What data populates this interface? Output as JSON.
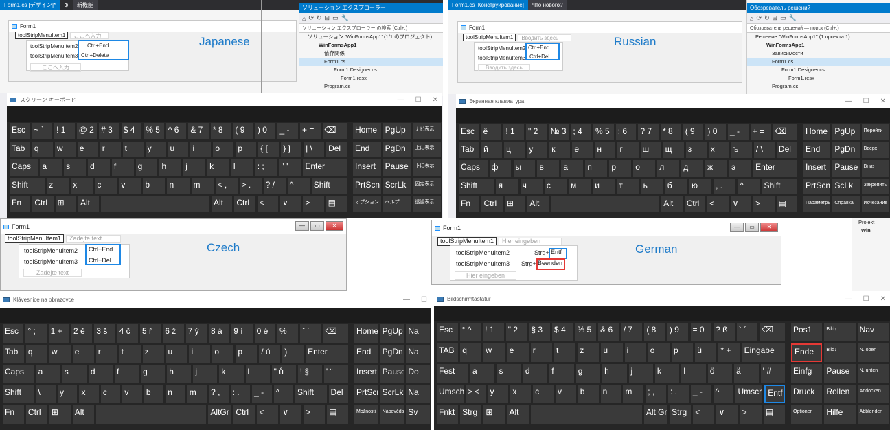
{
  "quadrants": {
    "japanese": {
      "label": "Japanese",
      "tabs": [
        "Form1.cs [デザイン]*",
        "⊕",
        "新機能"
      ],
      "form_title": "Form1",
      "menu_top": "toolStripMenuItem1",
      "menu_typehere": "ここへ入力",
      "items": [
        {
          "name": "toolStripMenuItem2",
          "shortcut": "Ctrl+End"
        },
        {
          "name": "toolStripMenuItem3",
          "shortcut": "Ctrl+Delete"
        }
      ],
      "item_typehere": "ここへ入力",
      "solution": {
        "title": "ソリューション エクスプローラー",
        "search": "ソリューション エクスプローラー の検索 (Ctrl+;)",
        "tree": [
          "ソリューション 'WinFormsApp1' (1/1 のプロジェクト)",
          "WinFormsApp1",
          "依存関係",
          "Form1.cs",
          "Form1.Designer.cs",
          "Form1.resx",
          "Program.cs"
        ]
      },
      "osk_title": "スクリーン キーボード",
      "osk_nav": [
        [
          "Home",
          "PgUp",
          "ナビ表示"
        ],
        [
          "End",
          "PgDn",
          "上に表示"
        ],
        [
          "Insert",
          "Pause",
          "下に表示"
        ],
        [
          "PrtScn",
          "ScrLk",
          "固定表示"
        ],
        [
          "オプション",
          "ヘルプ",
          "透過表示"
        ]
      ],
      "osk_rows": [
        [
          "Esc",
          "~ `",
          "! 1",
          "@ 2",
          "# 3",
          "$ 4",
          "% 5",
          "^ 6",
          "& 7",
          "* 8",
          "( 9",
          ") 0",
          "_ -",
          "+ =",
          "⌫"
        ],
        [
          "Tab",
          "q",
          "w",
          "e",
          "r",
          "t",
          "y",
          "u",
          "i",
          "o",
          "p",
          "{ [",
          "} ]",
          "| \\",
          "Del"
        ],
        [
          "Caps",
          "a",
          "s",
          "d",
          "f",
          "g",
          "h",
          "j",
          "k",
          "l",
          ": ;",
          "\" '",
          "Enter"
        ],
        [
          "Shift",
          "z",
          "x",
          "c",
          "v",
          "b",
          "n",
          "m",
          "< ,",
          "> .",
          "? /",
          "^",
          "Shift"
        ],
        [
          "Fn",
          "Ctrl",
          "⊞",
          "Alt",
          "",
          "Alt",
          "Ctrl",
          "<",
          "∨",
          ">",
          "▤"
        ]
      ]
    },
    "russian": {
      "label": "Russian",
      "tabs": [
        "Form1.cs [Конструирование]",
        "Что нового?"
      ],
      "form_title": "Form1",
      "menu_top": "toolStripMenuItem1",
      "menu_typehere": "Вводить здесь",
      "items": [
        {
          "name": "toolStripMenuItem2",
          "shortcut": "Ctrl+End"
        },
        {
          "name": "toolStripMenuItem3",
          "shortcut": "Ctrl+Del"
        }
      ],
      "item_typehere": "Вводить здесь",
      "solution": {
        "title": "Обозреватель решений",
        "search": "Обозреватель решений — поиск (Ctrl+;)",
        "tree": [
          "Решение \"WinFormsApp1\" (1 проекта 1)",
          "WinFormsApp1",
          "Зависимости",
          "Form1.cs",
          "Form1.Designer.cs",
          "Form1.resx",
          "Program.cs"
        ]
      },
      "osk_title": "Экранная клавиатура",
      "osk_nav": [
        [
          "Home",
          "PgUp",
          "Перейти"
        ],
        [
          "End",
          "PgDn",
          "Вверх"
        ],
        [
          "Insert",
          "Pause",
          "Вниз"
        ],
        [
          "PrtScn",
          "ScLk",
          "Закрепить"
        ],
        [
          "Параметры",
          "Справка",
          "Исчезание"
        ]
      ],
      "osk_rows": [
        [
          "Esc",
          "ё",
          "! 1",
          "\" 2",
          "№ 3",
          "; 4",
          "% 5",
          ": 6",
          "? 7",
          "* 8",
          "( 9",
          ") 0",
          "_ -",
          "+ =",
          "⌫"
        ],
        [
          "Tab",
          "й",
          "ц",
          "у",
          "к",
          "е",
          "н",
          "г",
          "ш",
          "щ",
          "з",
          "х",
          "ъ",
          "/ \\",
          "Del"
        ],
        [
          "Caps",
          "ф",
          "ы",
          "в",
          "а",
          "п",
          "р",
          "о",
          "л",
          "д",
          "ж",
          "э",
          "Enter"
        ],
        [
          "Shift",
          "я",
          "ч",
          "с",
          "м",
          "и",
          "т",
          "ь",
          "б",
          "ю",
          ", .",
          "^",
          "Shift"
        ],
        [
          "Fn",
          "Ctrl",
          "⊞",
          "Alt",
          "",
          "Alt",
          "Ctrl",
          "<",
          "∨",
          ">",
          "▤"
        ]
      ]
    },
    "czech": {
      "label": "Czech",
      "form_title": "Form1",
      "menu_top": "toolStripMenuItem1",
      "menu_typehere": "Zadejte text",
      "items": [
        {
          "name": "toolStripMenuItem2",
          "shortcut": "Ctrl+End"
        },
        {
          "name": "toolStripMenuItem3",
          "shortcut": "Ctrl+Del"
        }
      ],
      "item_typehere": "Zadejte text",
      "osk_title": "Klávesnice na obrazovce",
      "osk_nav": [
        [
          "Home",
          "PgUp",
          "Na"
        ],
        [
          "End",
          "PgDn",
          "Na"
        ],
        [
          "Insert",
          "Pause",
          "Do"
        ],
        [
          "PrtScn",
          "ScrLk",
          "Na"
        ],
        [
          "Možnosti",
          "Nápověda",
          "Sv"
        ]
      ],
      "osk_rows": [
        [
          "Esc",
          "° ;",
          "1 +",
          "2 ě",
          "3 š",
          "4 č",
          "5 ř",
          "6 ž",
          "7 ý",
          "8 á",
          "9 í",
          "0 é",
          "% =",
          "ˇ ´",
          "⌫"
        ],
        [
          "Tab",
          "q",
          "w",
          "e",
          "r",
          "t",
          "z",
          "u",
          "i",
          "o",
          "p",
          "/ ú",
          ")",
          "Enter"
        ],
        [
          "Caps",
          "a",
          "s",
          "d",
          "f",
          "g",
          "h",
          "j",
          "k",
          "l",
          "\" ů",
          "! §",
          "' ¨"
        ],
        [
          "Shift",
          "\\",
          "y",
          "x",
          "c",
          "v",
          "b",
          "n",
          "m",
          "? ,",
          ": .",
          "_ -",
          "^",
          "Shift",
          "Del"
        ],
        [
          "Fn",
          "Ctrl",
          "⊞",
          "Alt",
          "",
          "AltGr",
          "Ctrl",
          "<",
          "∨",
          ">",
          "▤"
        ]
      ]
    },
    "german": {
      "label": "German",
      "form_title": "Form1",
      "menu_top": "toolStripMenuItem1",
      "menu_typehere": "Hier eingeben",
      "items": [
        {
          "name": "toolStripMenuItem2",
          "shortcut_prefix": "Strg+",
          "shortcut_key": "Entf"
        },
        {
          "name": "toolStripMenuItem3",
          "shortcut_prefix": "Strg+",
          "shortcut_key": "Beenden"
        }
      ],
      "item_typehere": "Hier eingeben",
      "side_tree": [
        "Projekt",
        "Win"
      ],
      "osk_title": "Bildschirmtastatur",
      "osk_nav": [
        [
          "Pos1",
          "Bild↑",
          "Nav"
        ],
        [
          "Ende",
          "Bild↓",
          "N. oben"
        ],
        [
          "Einfg",
          "Pause",
          "N. unten"
        ],
        [
          "Druck",
          "Rollen",
          "Andocken"
        ],
        [
          "Optionen",
          "Hilfe",
          "Abblenden"
        ]
      ],
      "osk_rows": [
        [
          "Esc",
          "° ^",
          "! 1",
          "\" 2",
          "§ 3",
          "$ 4",
          "% 5",
          "& 6",
          "/ 7",
          "( 8",
          ") 9",
          "= 0",
          "? ß",
          "` ´",
          "⌫"
        ],
        [
          "TAB",
          "q",
          "w",
          "e",
          "r",
          "t",
          "z",
          "u",
          "i",
          "o",
          "p",
          "ü",
          "* +",
          "Eingabe"
        ],
        [
          "Fest",
          "a",
          "s",
          "d",
          "f",
          "g",
          "h",
          "j",
          "k",
          "l",
          "ö",
          "ä",
          "' #"
        ],
        [
          "Umsch",
          "> <",
          "y",
          "x",
          "c",
          "v",
          "b",
          "n",
          "m",
          "; ,",
          ": .",
          "_ -",
          "^",
          "Umsch",
          "Entf"
        ],
        [
          "Fnkt",
          "Strg",
          "⊞",
          "Alt",
          "",
          "Alt Gr",
          "Strg",
          "<",
          "∨",
          ">",
          "▤"
        ]
      ]
    }
  },
  "colors": {
    "highlight_blue": "#1e88e5",
    "highlight_red": "#e53935",
    "label_blue": "#1e7bc9",
    "osk_bg": "#262626",
    "key_bg": "#3a3a3a"
  }
}
